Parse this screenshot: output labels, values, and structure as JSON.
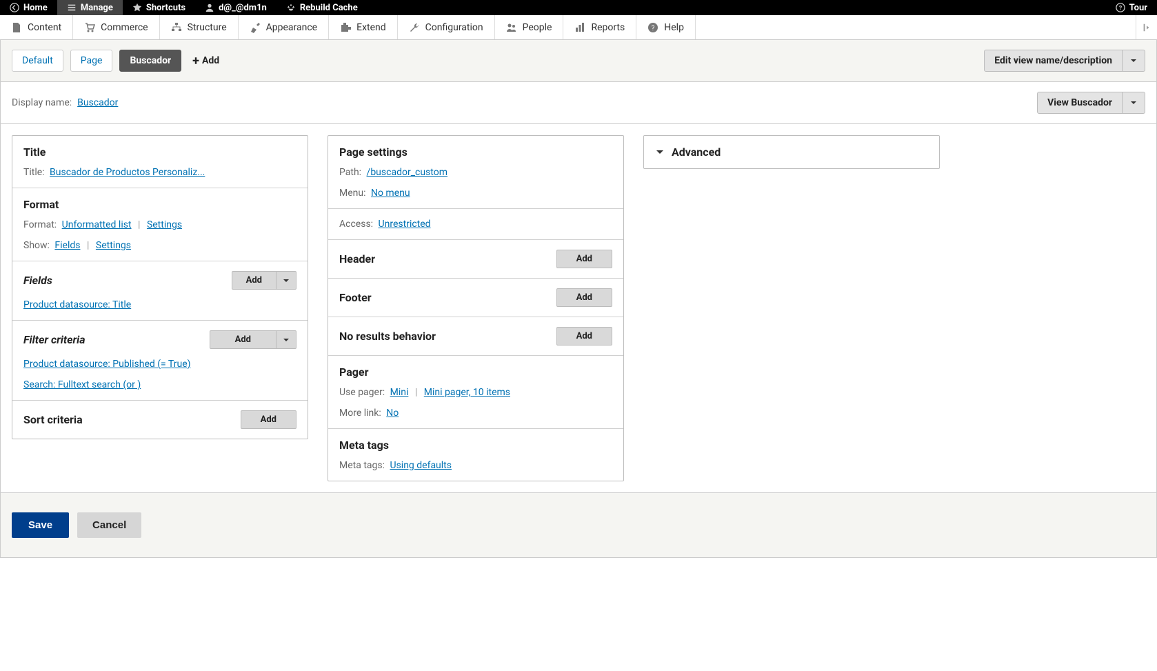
{
  "topbar": {
    "home": "Home",
    "manage": "Manage",
    "shortcuts": "Shortcuts",
    "user": "d@_@dm1n",
    "rebuild": "Rebuild Cache",
    "tour": "Tour"
  },
  "adminmenu": {
    "content": "Content",
    "commerce": "Commerce",
    "structure": "Structure",
    "appearance": "Appearance",
    "extend": "Extend",
    "configuration": "Configuration",
    "people": "People",
    "reports": "Reports",
    "help": "Help"
  },
  "tabs": {
    "items": [
      {
        "label": "Default",
        "active": false
      },
      {
        "label": "Page",
        "active": false
      },
      {
        "label": "Buscador",
        "active": true
      }
    ],
    "add": "Add",
    "editview": "Edit view name/description"
  },
  "display": {
    "label": "Display name:",
    "value": "Buscador",
    "viewbtn": "View Buscador"
  },
  "left": {
    "title": {
      "heading": "Title",
      "label": "Title:",
      "value": "Buscador de Productos Personaliz..."
    },
    "format": {
      "heading": "Format",
      "flabel": "Format:",
      "fvalue": "Unformatted list",
      "fsettings": "Settings",
      "slabel": "Show:",
      "svalue": "Fields",
      "ssettings": "Settings"
    },
    "fields": {
      "heading": "Fields",
      "add": "Add",
      "item1": "Product datasource: Title"
    },
    "filter": {
      "heading": "Filter criteria",
      "add": "Add",
      "item1": "Product datasource: Published (= True)",
      "item2": "Search: Fulltext search (or )"
    },
    "sort": {
      "heading": "Sort criteria",
      "add": "Add"
    }
  },
  "right": {
    "pageset": {
      "heading": "Page settings",
      "pathl": "Path:",
      "pathv": "/buscador_custom",
      "menul": "Menu:",
      "menuv": "No menu",
      "accessl": "Access:",
      "accessv": "Unrestricted"
    },
    "header": {
      "heading": "Header",
      "add": "Add"
    },
    "footer": {
      "heading": "Footer",
      "add": "Add"
    },
    "nores": {
      "heading": "No results behavior",
      "add": "Add"
    },
    "pager": {
      "heading": "Pager",
      "usel": "Use pager:",
      "usev": "Mini",
      "usesettings": "Mini pager, 10 items",
      "morel": "More link:",
      "morev": "No"
    },
    "meta": {
      "heading": "Meta tags",
      "label": "Meta tags:",
      "value": "Using defaults"
    }
  },
  "advanced": {
    "heading": "Advanced"
  },
  "actions": {
    "save": "Save",
    "cancel": "Cancel"
  }
}
